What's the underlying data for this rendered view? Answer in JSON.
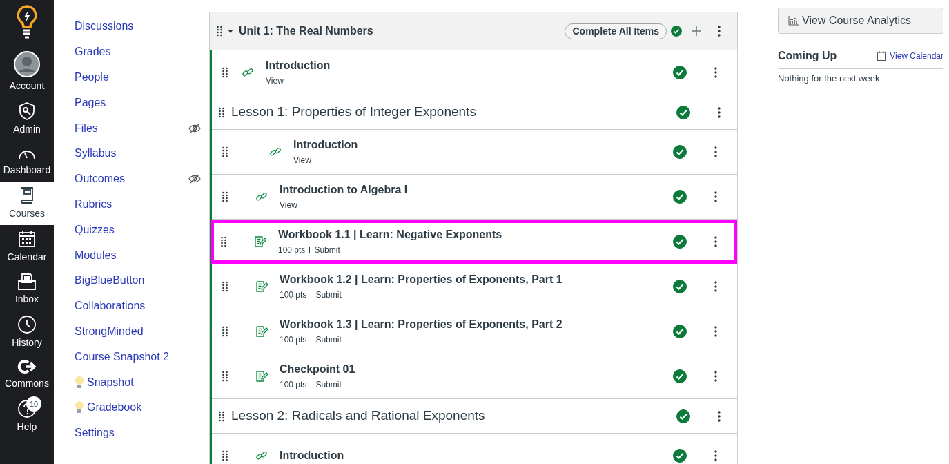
{
  "global_nav": [
    {
      "label": "Account",
      "selected": false
    },
    {
      "label": "Admin",
      "selected": false
    },
    {
      "label": "Dashboard",
      "selected": false
    },
    {
      "label": "Courses",
      "selected": true
    },
    {
      "label": "Calendar",
      "selected": false
    },
    {
      "label": "Inbox",
      "selected": false
    },
    {
      "label": "History",
      "selected": false
    },
    {
      "label": "Commons",
      "selected": false
    },
    {
      "label": "Help",
      "selected": false,
      "badge": "10"
    }
  ],
  "course_nav": [
    {
      "label": "Discussions",
      "hidden": false
    },
    {
      "label": "Grades",
      "hidden": false
    },
    {
      "label": "People",
      "hidden": false
    },
    {
      "label": "Pages",
      "hidden": false
    },
    {
      "label": "Files",
      "hidden": true
    },
    {
      "label": "Syllabus",
      "hidden": false
    },
    {
      "label": "Outcomes",
      "hidden": true
    },
    {
      "label": "Rubrics",
      "hidden": false
    },
    {
      "label": "Quizzes",
      "hidden": false
    },
    {
      "label": "Modules",
      "hidden": false
    },
    {
      "label": "BigBlueButton",
      "hidden": false
    },
    {
      "label": "Collaborations",
      "hidden": false
    },
    {
      "label": "StrongMinded",
      "hidden": false
    },
    {
      "label": "Course Snapshot 2",
      "hidden": false
    },
    {
      "label": "Snapshot",
      "hidden": false,
      "bulb": true
    },
    {
      "label": "Gradebook",
      "hidden": false,
      "bulb": true
    },
    {
      "label": "Settings",
      "hidden": false
    }
  ],
  "module": {
    "title": "Unit 1: The Real Numbers",
    "expanded": true,
    "complete_button": "Complete All Items",
    "completed": true,
    "items": [
      {
        "kind": "link",
        "title": "Introduction",
        "meta": [
          "View"
        ],
        "completed": true,
        "highlighted": false
      },
      {
        "kind": "header",
        "title": "Lesson 1: Properties of Integer Exponents",
        "completed": true,
        "children": [
          {
            "kind": "group",
            "children": [
              {
                "kind": "link",
                "title": "Introduction",
                "meta": [
                  "View"
                ],
                "completed": true,
                "highlighted": false
              }
            ]
          },
          {
            "kind": "link",
            "title": "Introduction to Algebra I",
            "meta": [
              "View"
            ],
            "completed": true,
            "highlighted": false
          },
          {
            "kind": "assignment",
            "title": "Workbook 1.1 | Learn: Negative Exponents",
            "meta": [
              "100 pts",
              "Submit"
            ],
            "completed": true,
            "highlighted": true
          },
          {
            "kind": "assignment",
            "title": "Workbook 1.2 | Learn: Properties of Exponents, Part 1",
            "meta": [
              "100 pts",
              "Submit"
            ],
            "completed": true,
            "highlighted": false
          },
          {
            "kind": "assignment",
            "title": "Workbook 1.3 | Learn: Properties of Exponents, Part 2",
            "meta": [
              "100 pts",
              "Submit"
            ],
            "completed": true,
            "highlighted": false
          },
          {
            "kind": "assignment",
            "title": "Checkpoint 01",
            "meta": [
              "100 pts",
              "Submit"
            ],
            "completed": true,
            "highlighted": false
          }
        ]
      },
      {
        "kind": "header",
        "title": "Lesson 2: Radicals and Rational Exponents",
        "completed": true,
        "children": [
          {
            "kind": "link",
            "title": "Introduction",
            "completed": true,
            "highlighted": false
          }
        ]
      }
    ]
  },
  "sidebar": {
    "analytics_button": "View Course Analytics",
    "coming_up": {
      "title": "Coming Up",
      "calendar_link": "View Calendar",
      "empty_text": "Nothing for the next week"
    }
  }
}
